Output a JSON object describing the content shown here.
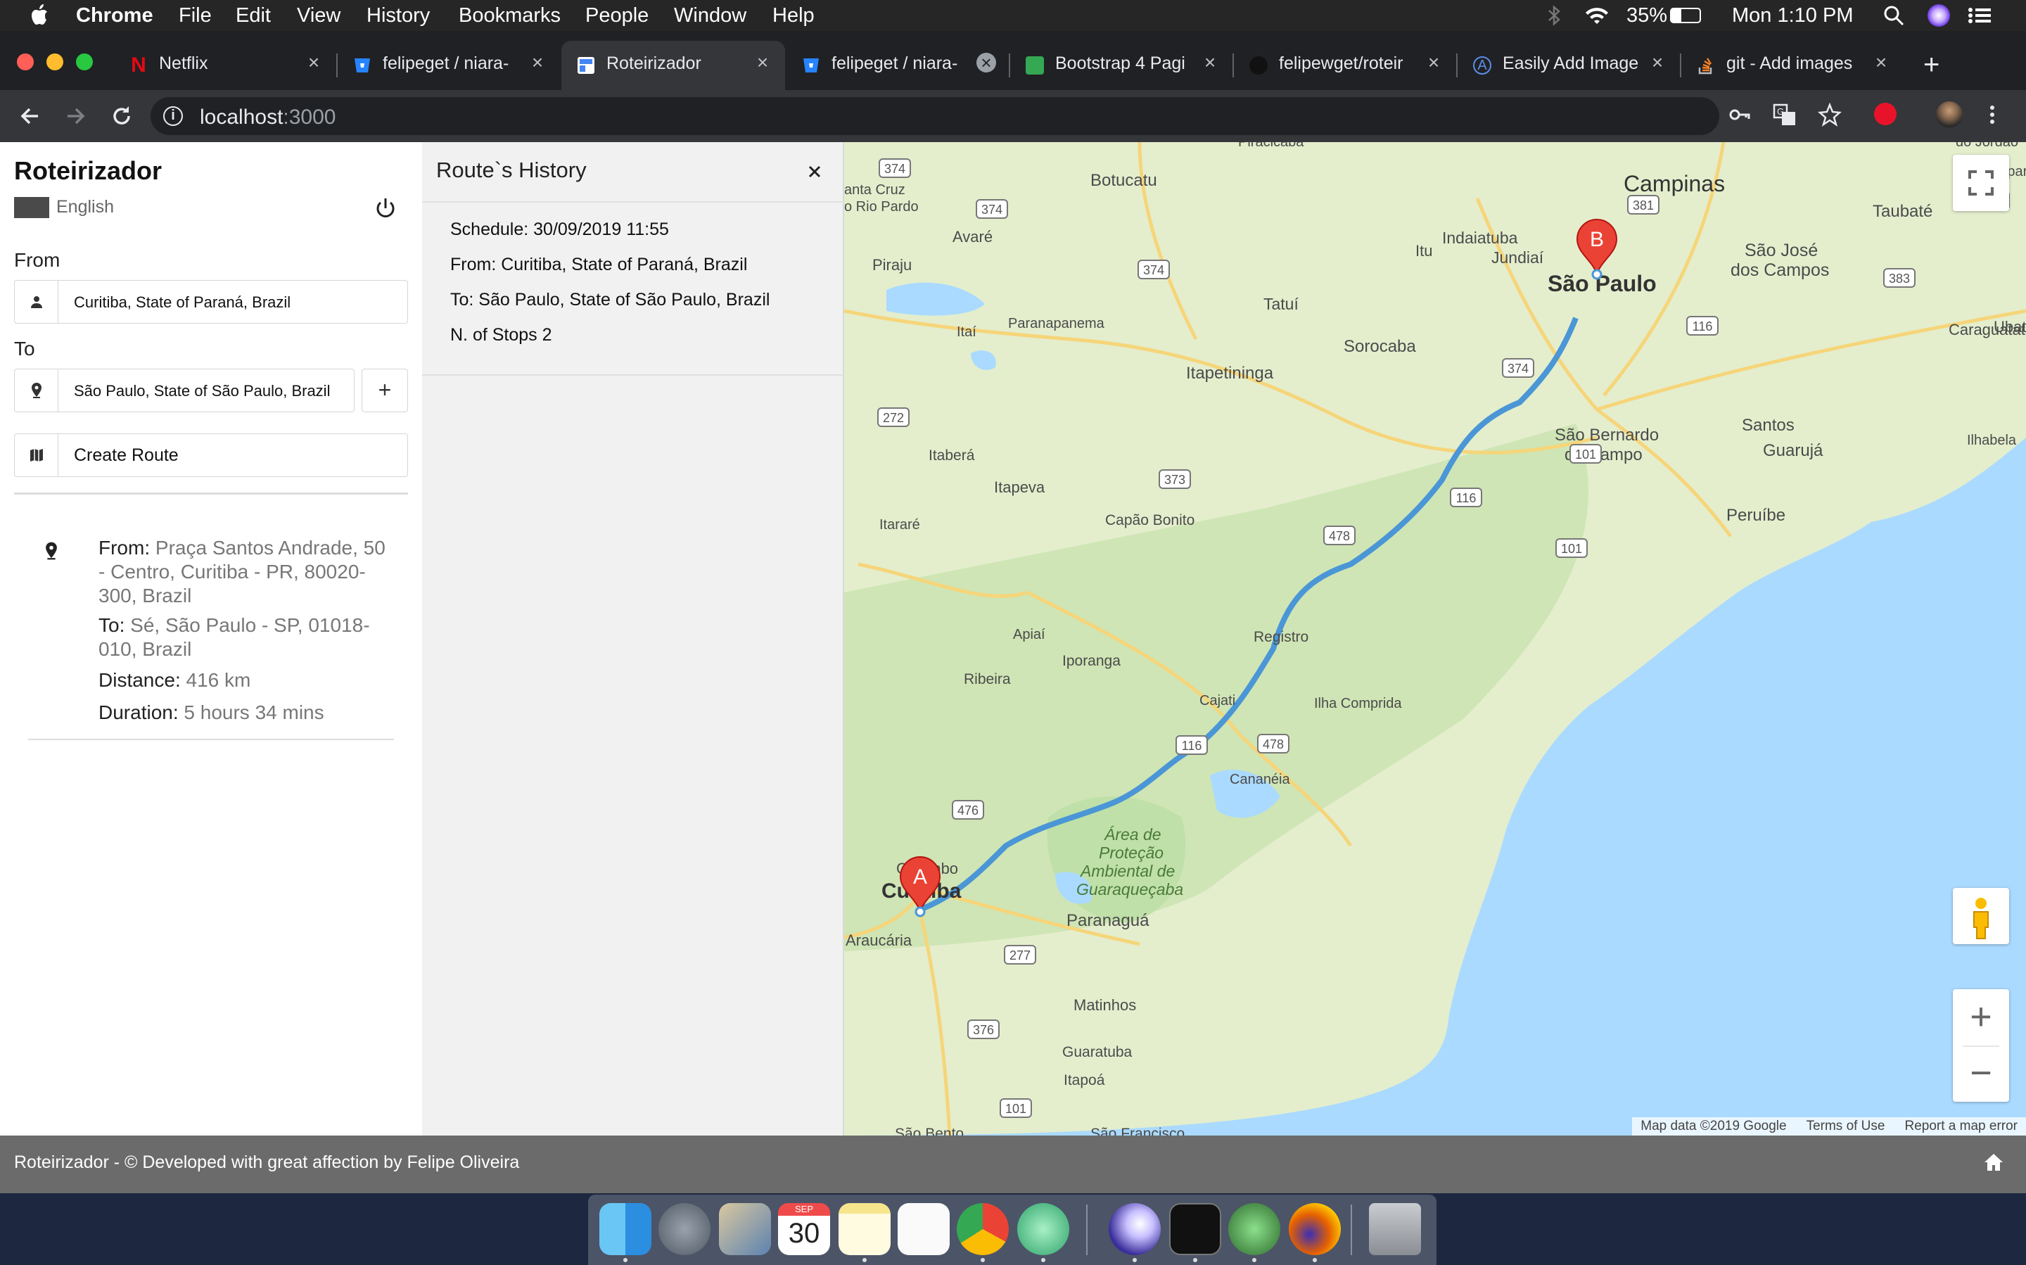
{
  "menubar": {
    "app": "Chrome",
    "menus": [
      "File",
      "Edit",
      "View",
      "History",
      "Bookmarks",
      "People",
      "Window",
      "Help"
    ],
    "battery": "35%",
    "clock": "Mon 1:10 PM"
  },
  "tabs": [
    {
      "title": "Netflix",
      "favicon_color": "#e50914",
      "favicon_letter": "N"
    },
    {
      "title": "felipeget / niara-",
      "favicon_color": "#2684ff",
      "favicon_letter": ""
    },
    {
      "title": "Roteirizador",
      "favicon_color": "#4285f4",
      "favicon_letter": ""
    },
    {
      "title": "felipeget / niara-",
      "favicon_color": "#2684ff",
      "favicon_letter": ""
    },
    {
      "title": "Bootstrap 4 Pagi",
      "favicon_color": "#34a853",
      "favicon_letter": ""
    },
    {
      "title": "felipewget/roteir",
      "favicon_color": "#222222",
      "favicon_letter": ""
    },
    {
      "title": "Easily Add Image",
      "favicon_color": "#3b6fd8",
      "favicon_letter": "A"
    },
    {
      "title": "git - Add images",
      "favicon_color": "#f48024",
      "favicon_letter": ""
    }
  ],
  "address": {
    "host": "localhost",
    "port": ":3000"
  },
  "sidebar": {
    "brand": "Roteirizador",
    "language": "English",
    "from_label": "From",
    "from_value": "Curitiba, State of Paraná, Brazil",
    "to_label": "To",
    "to_value": "São Paulo, State of São Paulo, Brazil",
    "add_stop": "+",
    "create_route": "Create Route"
  },
  "route_summary": {
    "from_label": "From:",
    "from_value": "Praça Santos Andrade, 50 - Centro, Curitiba - PR, 80020-300, Brazil",
    "to_label": "To:",
    "to_value": "Sé, São Paulo - SP, 01018-010, Brazil",
    "distance_label": "Distance:",
    "distance_value": "416 km",
    "duration_label": "Duration:",
    "duration_value": "5 hours 34 mins"
  },
  "history": {
    "title": "Route`s History",
    "close": "×",
    "schedule": "Schedule: 30/09/2019 11:55",
    "from": "From: Curitiba, State of Paraná, Brazil",
    "to": "To: São Paulo, State of São Paulo, Brazil",
    "stops": "N. of Stops 2"
  },
  "map": {
    "marker_a": "A",
    "marker_b": "B",
    "places": {
      "campinas": "Campinas",
      "sao_paulo": "São Paulo",
      "curitiba": "Curitiba",
      "sorocaba": "Sorocaba",
      "taubate": "Taubaté",
      "sao_jose": "São José dos Campos",
      "santos": "Santos",
      "guaruja": "Guarujá",
      "sao_bernardo": "São Bernardo do Campo",
      "registro": "Registro",
      "peruibe": "Peruíbe",
      "paranagua": "Paranaguá",
      "itapetininga": "Itapetininga",
      "botucatu": "Botucatu",
      "indaiatuba": "Indaiatuba",
      "jundiai": "Jundiaí",
      "itu": "Itu",
      "tatui": "Tatuí",
      "piraju": "Piraju",
      "avare": "Avaré",
      "paranapanema": "Paranapanema",
      "itai": "Itaí",
      "itabera": "Itaberá",
      "itapeva": "Itapeva",
      "capao_bonito": "Capão Bonito",
      "itarare": "Itararé",
      "apiai": "Apiaí",
      "iporanga": "Iporanga",
      "ribeira": "Ribeira",
      "cajati": "Cajati",
      "ilha_comprida": "Ilha Comprida",
      "cananeia": "Cananéia",
      "colombo": "Colombo",
      "araucaria": "Araucária",
      "matinhos": "Matinhos",
      "guaratuba": "Guaratuba",
      "itapoa": "Itapoá",
      "ubatuba": "Ubatuba",
      "caraguatatuba": "Caraguatatuba",
      "ilhabela": "Ilhabela",
      "aparecida": "Apare",
      "santa_cruz": "anta Cruz\no Rio Pardo",
      "sao_bento": "São Bento",
      "sao_francisco": "São Francisco",
      "apa": "Área de\nProteção\nAmbiental de\nGuaraqueçaba",
      "piracicaba": "Piracicaba",
      "sao_joao": "do Jordão"
    },
    "shields": [
      "374",
      "374",
      "374",
      "381",
      "116",
      "383",
      "374",
      "116",
      "272",
      "373",
      "478",
      "116",
      "101",
      "101",
      "476",
      "478",
      "116",
      "277",
      "376",
      "101"
    ],
    "footer_data": "Map data ©2019 Google",
    "footer_terms": "Terms of Use",
    "footer_report": "Report a map error",
    "zoom_in": "+",
    "zoom_out": "−"
  },
  "footer": {
    "text": "Roteirizador - © Developed with great affection by Felipe Oliveira"
  },
  "dock": {
    "calendar_month": "SEP",
    "calendar_day": "30"
  },
  "colors": {
    "route": "#4a96d6",
    "marker": "#ea4335",
    "water": "#aadaff",
    "land": "#e4eecd"
  }
}
